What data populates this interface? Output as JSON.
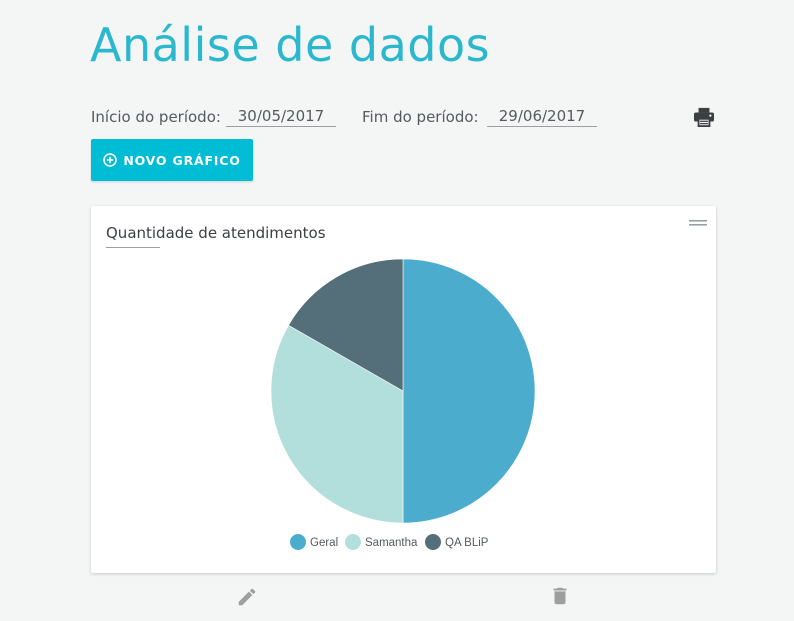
{
  "page": {
    "title": "Análise de dados"
  },
  "period": {
    "start_label": "Início do período:",
    "start_value": "30/05/2017",
    "end_label": "Fim do período:",
    "end_value": "29/06/2017"
  },
  "toolbar": {
    "new_chart_label": "NOVO GRÁFICO",
    "print_icon": "print-icon"
  },
  "card": {
    "title": "Quantidade de atendimentos",
    "menu_icon": "drag-handle-icon",
    "edit_icon": "edit-icon",
    "delete_icon": "delete-icon"
  },
  "chart_data": {
    "type": "pie",
    "categories": [
      "Geral",
      "Samantha",
      "QA BLiP"
    ],
    "values": [
      50,
      33.3,
      16.7
    ],
    "colors": [
      "#4bacce",
      "#b2dfdb",
      "#546e7a"
    ],
    "legend": "bottom"
  },
  "colors": {
    "accent": "#00bcd4",
    "title": "#2bb8cf"
  }
}
